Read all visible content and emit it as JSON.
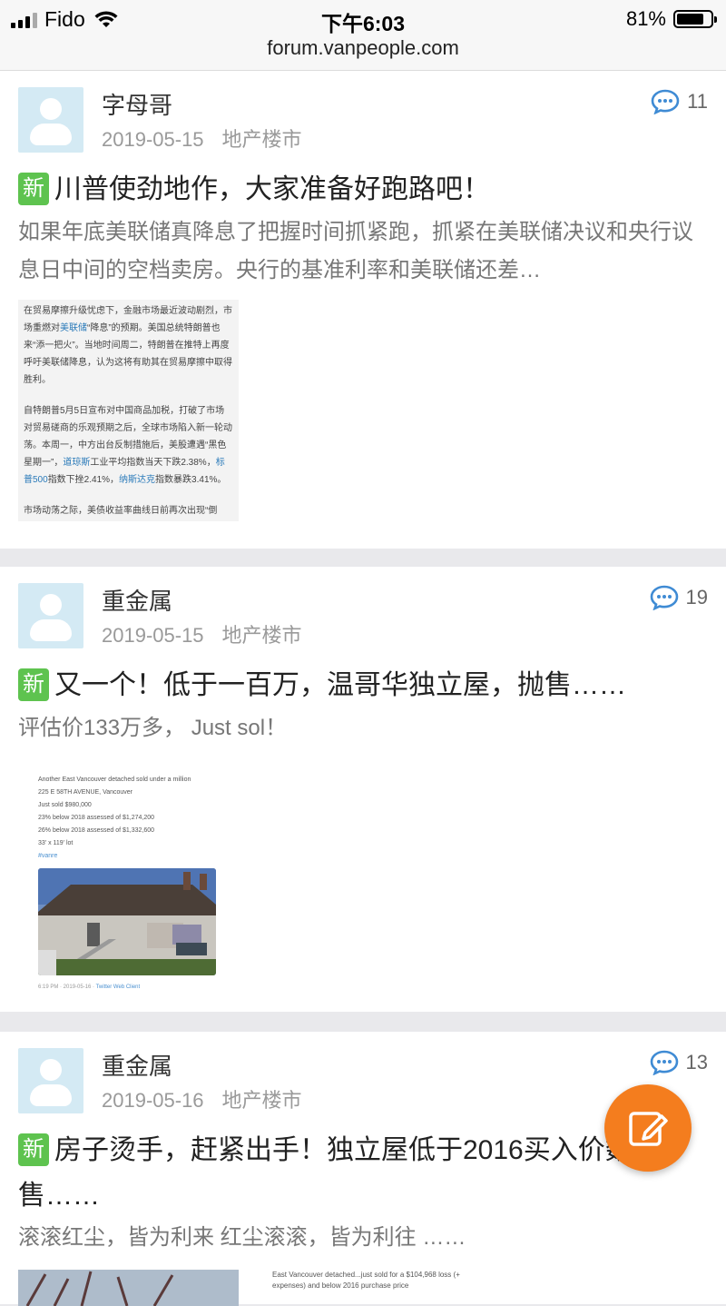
{
  "status_bar": {
    "carrier": "Fido",
    "time": "下午6:03",
    "url": "forum.vanpeople.com",
    "battery_percent": "81%",
    "battery_level": 0.81
  },
  "posts": [
    {
      "author": "字母哥",
      "date": "2019-05-15",
      "category": "地产楼市",
      "comment_count": "11",
      "badge": "新",
      "title": "川普使劲地作，大家准备好跑路吧！",
      "excerpt": "如果年底美联储真降息了把握时间抓紧跑，抓紧在美联储决议和央行议息日中间的空档卖房。央行的基准利率和美联储还差…",
      "thumb": {
        "p1a": "在贸易摩擦升级忧虑下，金融市场最近波动剧烈，市场重燃对",
        "p1_link": "美联储",
        "p1b": "“降息”的预期。美国总统特朗普也来“添一把火”。当地时间周二，特朗普在推特上再度呼吁美联储降息，认为这将有助其在贸易摩擦中取得胜利。",
        "p2a": "自特朗普5月5日宣布对中国商品加税，打破了市场对贸易磋商的乐观预期之后，全球市场陷入新一轮动荡。本周一，中方出台反制措施后，美股遭遇“黑色星期一”，",
        "p2_link1": "道琼斯",
        "p2b": "工业平均指数当天下跌2.38%，",
        "p2_link2": "标普500",
        "p2c": "指数下挫2.41%，",
        "p2_link3": "纳斯达克",
        "p2d": "指数暴跌3.41%。",
        "p3": "市场动荡之际，美债收益率曲线日前再次出现“倒"
      }
    },
    {
      "author": "重金属",
      "date": "2019-05-15",
      "category": "地产楼市",
      "comment_count": "19",
      "badge": "新",
      "title": "又一个！低于一百万，温哥华独立屋，抛售……",
      "excerpt": "评估价133万多， Just sol！",
      "tweet": {
        "line1": "Another East Vancouver detached sold under a million",
        "line2": "225 E 58TH AVENUE, Vancouver",
        "line3": "Just sold $980,000",
        "line4": "23% below 2018 assessed of $1,274,200",
        "line5": "26% below 2018 assessed of $1,332,600",
        "line6": "33' x 119' lot",
        "hashtag": "#vanre",
        "footer_time": "6:19 PM · 2019-05-16 · ",
        "footer_client": "Twitter Web Client"
      }
    },
    {
      "author": "重金属",
      "date": "2019-05-16",
      "category": "地产楼市",
      "comment_count": "13",
      "badge": "新",
      "title": "房子烫手，赶紧出手！独立屋低于2016买入价数抛售……",
      "excerpt": "滚滚红尘，皆为利来 红尘滚滚，皆为利往 ……",
      "thumb2_text": "East Vancouver detached...just sold for a $104,968 loss (+ expenses) and below 2016 purchase price"
    }
  ],
  "icons": {
    "comment": "comment-bubble-icon",
    "avatar": "user-avatar-icon",
    "compose": "compose-edit-icon",
    "wifi": "wifi-icon",
    "signal": "signal-bars-icon",
    "battery": "battery-icon"
  },
  "colors": {
    "badge_green": "#5ec34f",
    "fab_orange": "#f47d1e",
    "comment_blue": "#3f8bd4",
    "avatar_bg": "#d4eaf4"
  }
}
